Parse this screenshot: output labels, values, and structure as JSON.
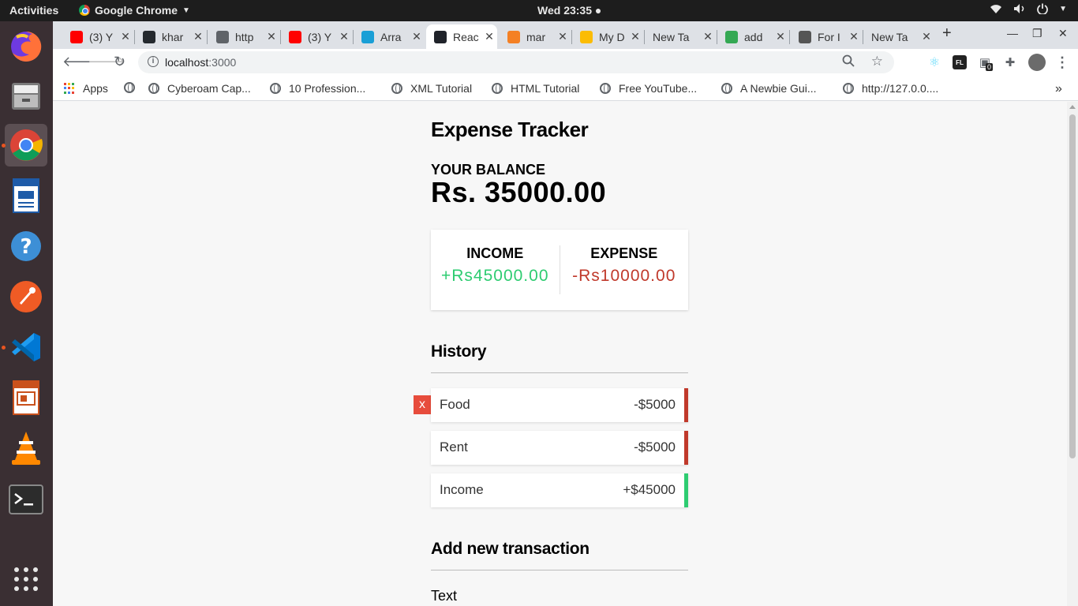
{
  "system": {
    "activities": "Activities",
    "app_name": "Google Chrome",
    "clock": "Wed 23:35"
  },
  "browser": {
    "tabs": [
      {
        "label": "(3) Y",
        "favicon": "youtube-icon",
        "color": "#ff0000"
      },
      {
        "label": "khar",
        "favicon": "github-icon",
        "color": "#24292e"
      },
      {
        "label": "http",
        "favicon": "globe-icon",
        "color": "#5f6368"
      },
      {
        "label": "(3) Y",
        "favicon": "youtube-icon",
        "color": "#ff0000"
      },
      {
        "label": "Arra",
        "favicon": "array-icon",
        "color": "#1a9fd6"
      },
      {
        "label": "Reac",
        "favicon": "react-icon",
        "color": "#20232a",
        "active": true
      },
      {
        "label": "mar",
        "favicon": "stackoverflow-icon",
        "color": "#f48024"
      },
      {
        "label": "My D",
        "favicon": "drive-icon",
        "color": "#fbbc04"
      },
      {
        "label": "New Ta",
        "favicon": "",
        "color": ""
      },
      {
        "label": "add",
        "favicon": "sheet-icon",
        "color": "#34a853"
      },
      {
        "label": "For I",
        "favicon": "shield-icon",
        "color": "#555"
      },
      {
        "label": "New Ta",
        "favicon": "",
        "color": ""
      }
    ],
    "url_host": "localhost",
    "url_port": ":3000",
    "bookmarks": [
      {
        "label": "Apps"
      },
      {
        "label": ""
      },
      {
        "label": "Cyberoam Cap..."
      },
      {
        "label": "10 Profession..."
      },
      {
        "label": "XML Tutorial"
      },
      {
        "label": "HTML Tutorial"
      },
      {
        "label": "Free YouTube..."
      },
      {
        "label": "A Newbie Gui..."
      },
      {
        "label": "http://127.0.0...."
      }
    ],
    "bookmarks_overflow": "»",
    "extension_badge": "0"
  },
  "app": {
    "title": "Expense Tracker",
    "balance_label": "YOUR BALANCE",
    "balance_value": "Rs. 35000.00",
    "income_label": "INCOME",
    "income_value": "+Rs45000.00",
    "expense_label": "EXPENSE",
    "expense_value": "-Rs10000.00",
    "history_title": "History",
    "transactions": [
      {
        "name": "Food",
        "amount": "-$5000",
        "type": "minus",
        "delete_label": "x"
      },
      {
        "name": "Rent",
        "amount": "-$5000",
        "type": "minus"
      },
      {
        "name": "Income",
        "amount": "+$45000",
        "type": "plus"
      }
    ],
    "add_title": "Add new transaction",
    "text_label": "Text"
  },
  "colors": {
    "plus": "#2ecc71",
    "minus": "#c0392b"
  }
}
